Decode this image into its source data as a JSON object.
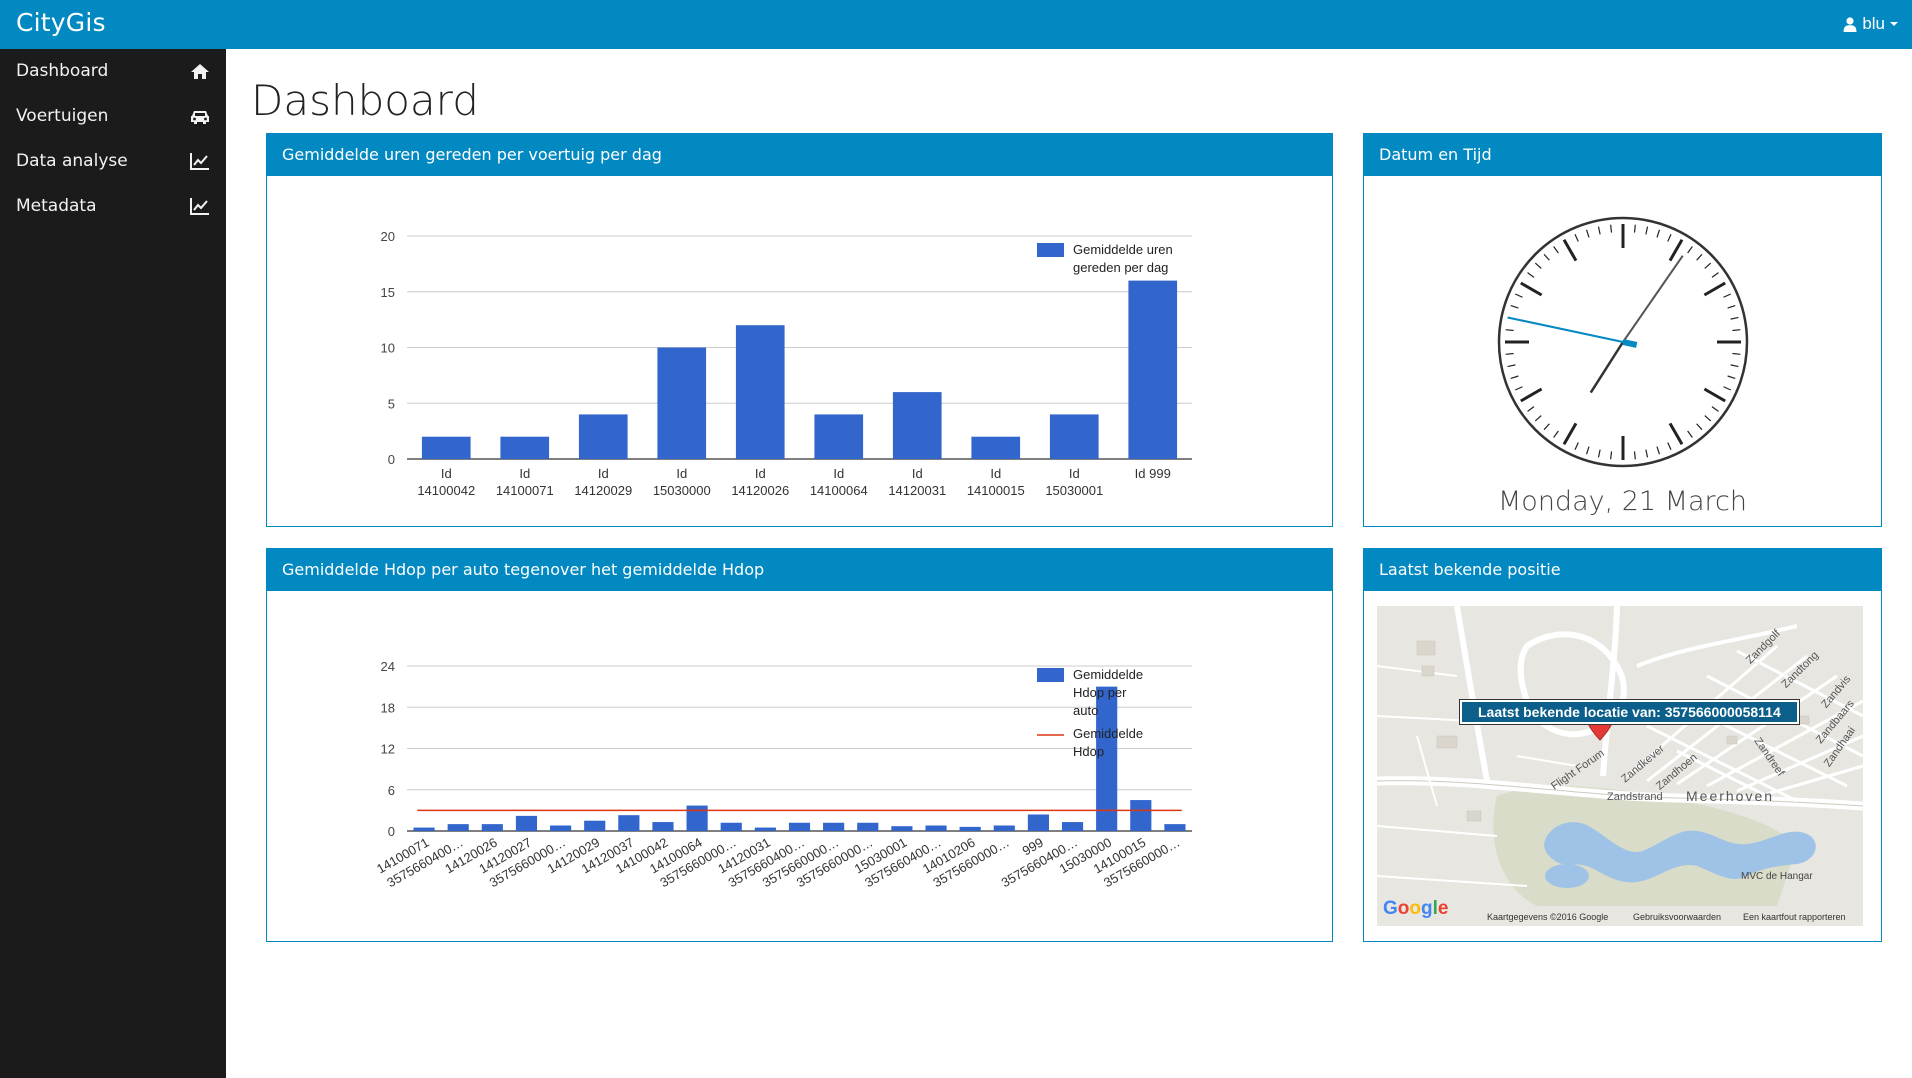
{
  "app": {
    "brand": "CityGis",
    "user": "blu"
  },
  "sidebar": {
    "items": [
      {
        "label": "Dashboard",
        "icon": "home-icon"
      },
      {
        "label": "Voertuigen",
        "icon": "car-icon"
      },
      {
        "label": "Data analyse",
        "icon": "line-chart-icon"
      },
      {
        "label": "Metadata",
        "icon": "line-chart-icon"
      }
    ]
  },
  "page": {
    "title": "Dashboard"
  },
  "panels": {
    "hours": {
      "title": "Gemiddelde uren gereden per voertuig per dag"
    },
    "clock": {
      "title": "Datum en Tijd",
      "date": "Monday, 21 March"
    },
    "hdop": {
      "title": "Gemiddelde Hdop per auto tegenover het gemiddelde Hdop"
    },
    "position": {
      "title": "Laatst bekende positie",
      "label": "Laatst bekende locatie van: 357566000058114",
      "google": "Google",
      "footer": [
        "Kaartgegevens ©2016 Google",
        "Gebruiksvoorwaarden",
        "Een kaartfout rapporteren"
      ],
      "places": [
        "Meerhoven",
        "Zandstrand",
        "Zandkever",
        "Zandhoen",
        "Flight Forum",
        "MVC de Hangar",
        "Zandgolf",
        "Zandtong",
        "Zandvis",
        "Zandbaars",
        "Zandhaai",
        "Zandreef"
      ]
    }
  },
  "colors": {
    "accent": "#0289c1",
    "bar": "#3366cc",
    "avg_line": "#dc3912",
    "sidebar": "#1b1b1b"
  },
  "clock": {
    "hour": 7,
    "minute": 5,
    "second": 47
  },
  "chart_data": [
    {
      "type": "bar",
      "categories": [
        "Id 14100042",
        "Id 14100071",
        "Id 14120029",
        "Id 15030000",
        "Id 14120026",
        "Id 14100064",
        "Id 14120031",
        "Id 14100015",
        "Id 15030001",
        "Id 999"
      ],
      "series": [
        {
          "name": "Gemiddelde uren gereden per dag",
          "values": [
            2,
            2,
            4,
            10,
            12,
            4,
            6,
            2,
            4,
            16
          ]
        }
      ],
      "yticks": [
        0,
        5,
        10,
        15,
        20
      ],
      "ylim": [
        0,
        20
      ],
      "legend": "right",
      "grid": true
    },
    {
      "type": "bar",
      "categories": [
        "14100071",
        "3575660400…",
        "14120026",
        "14120027",
        "3575660000…",
        "14120029",
        "14120037",
        "14100042",
        "14100064",
        "3575660000…",
        "14120031",
        "3575660400…",
        "3575660000…",
        "3575660000…",
        "15030001",
        "3575660400…",
        "14010206",
        "3575660000…",
        "999",
        "3575660400…",
        "15030000",
        "14100015",
        "3575660000…"
      ],
      "series": [
        {
          "name": "Gemiddelde Hdop per auto",
          "values": [
            0.5,
            1,
            1,
            2.2,
            0.8,
            1.5,
            2.3,
            1.3,
            3.7,
            1.2,
            0.5,
            1.2,
            1.2,
            1.2,
            0.7,
            0.8,
            0.6,
            0.8,
            2.4,
            1.3,
            21,
            4.5,
            1
          ]
        },
        {
          "name": "Gemiddelde Hdop",
          "type": "line",
          "value": 3.0
        }
      ],
      "yticks": [
        0,
        6,
        12,
        18,
        24
      ],
      "ylim": [
        0,
        24
      ],
      "legend": "right",
      "grid": true
    }
  ]
}
